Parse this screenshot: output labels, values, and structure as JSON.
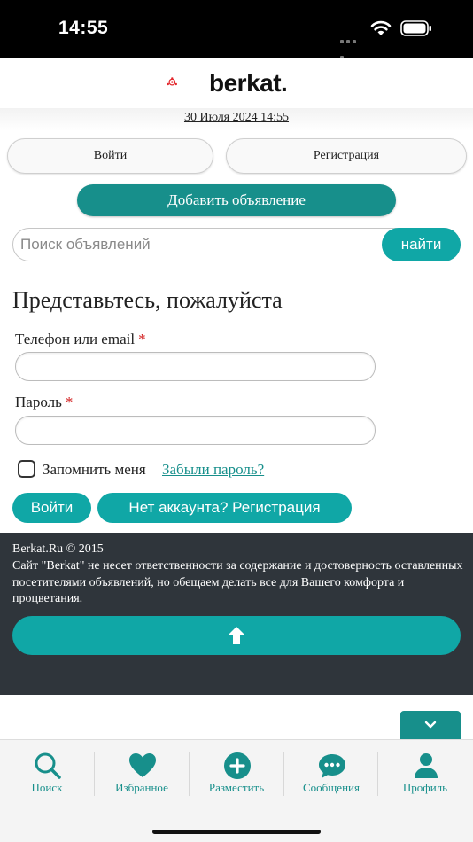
{
  "status_bar": {
    "time": "14:55"
  },
  "header": {
    "logo_text": "berkat.",
    "date": "30 Июля 2024 14:55"
  },
  "auth": {
    "login_label": "Войти",
    "register_label": "Регистрация"
  },
  "add_ad": {
    "label": "Добавить объявление"
  },
  "search": {
    "placeholder": "Поиск объявлений",
    "button_label": "найти"
  },
  "login_form": {
    "title": "Представьтесь, пожалуйста",
    "login_label": "Телефон или email",
    "password_label": "Пароль",
    "required_mark": "*",
    "remember_label": "Запомнить меня",
    "forgot_link": "Забыли пароль?",
    "submit_label": "Войти",
    "no_account_label": "Нет аккаунта? Регистрация"
  },
  "footer": {
    "copyright": "Berkat.Ru © 2015",
    "disclaimer": "Сайт \"Berkat\" не несет ответственности за содержание и достоверность оставленных посетителями объявлений, но обещаем делать все для Вашего комфорта и процветания."
  },
  "tab_bar": {
    "tabs": [
      {
        "label": "Поиск",
        "icon": "search-icon"
      },
      {
        "label": "Избранное",
        "icon": "heart-icon"
      },
      {
        "label": "Разместить",
        "icon": "plus-circle-icon"
      },
      {
        "label": "Сообщения",
        "icon": "chat-icon"
      },
      {
        "label": "Профиль",
        "icon": "user-icon"
      }
    ]
  },
  "colors": {
    "brand_teal": "#10a7a6",
    "dark_teal": "#178f8b",
    "footer_bg": "#2f353b",
    "logo_red": "#e3262b"
  }
}
